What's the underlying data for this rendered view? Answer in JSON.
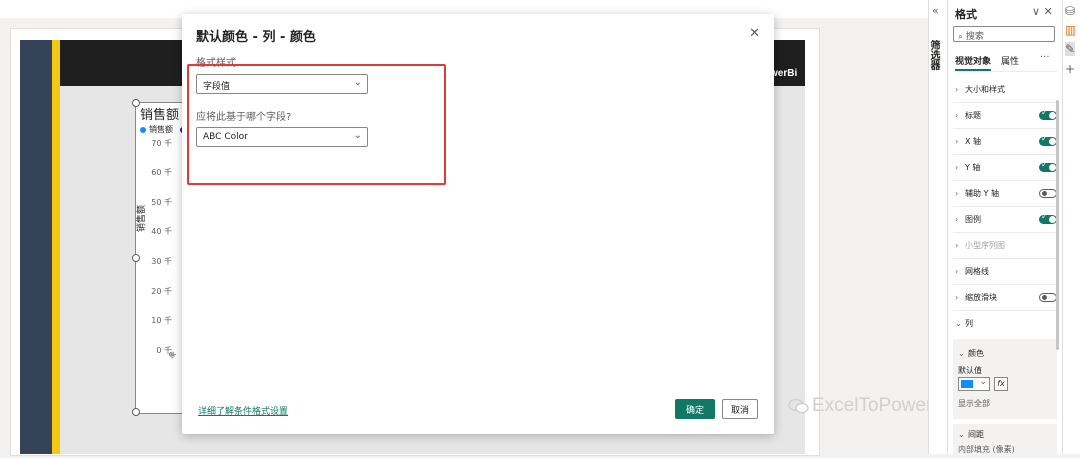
{
  "report": {
    "logo_text": "werBi",
    "chart_title": "销售额 和",
    "legend": [
      "销售额"
    ],
    "y_axis_label": "销售额",
    "y_ticks": [
      "70 千",
      "60 千",
      "50 千",
      "40 千",
      "30 千",
      "20 千",
      "10 千",
      "0 千"
    ],
    "x_tick": "象"
  },
  "dialog": {
    "title": "默认颜色 - 列 - 颜色",
    "close": "✕",
    "format_style_label": "格式样式",
    "format_style_value": "字段值",
    "field_question": "应将此基于哪个字段?",
    "field_value": "ABC Color",
    "learn_more": "详细了解条件格式设置",
    "ok": "确定",
    "cancel": "取消"
  },
  "filter_pane": {
    "collapse": "«",
    "label": "筛选器"
  },
  "format_pane": {
    "title": "格式",
    "actions": "∨ ✕",
    "search_placeholder": "搜索",
    "tabs": [
      "视觉对象",
      "属性"
    ],
    "more": "···",
    "sections": [
      {
        "label": "大小和样式",
        "toggle": null,
        "dim": false
      },
      {
        "label": "标题",
        "toggle": "on",
        "dim": false
      },
      {
        "label": "X 轴",
        "toggle": "on",
        "dim": false
      },
      {
        "label": "Y 轴",
        "toggle": "on",
        "dim": false
      },
      {
        "label": "辅助 Y 轴",
        "toggle": "off",
        "dim": false
      },
      {
        "label": "图例",
        "toggle": "on",
        "dim": false
      },
      {
        "label": "小型序列图",
        "toggle": null,
        "dim": true
      },
      {
        "label": "网格线",
        "toggle": null,
        "dim": false
      },
      {
        "label": "缩放滑块",
        "toggle": "off",
        "dim": false
      }
    ],
    "columns_label": "列",
    "color_group": "颜色",
    "default_value_label": "默认值",
    "color_hex": "#118DFF",
    "fx": "fx",
    "show_all": "显示全部",
    "spacing_group": "间距",
    "inner_padding": "内部填充 (像素)"
  },
  "watermark": "ExcelToPowerBI",
  "colors": {
    "accent": "#117865",
    "highlight_box": "#E03A3A",
    "navy": "#344358",
    "yellow": "#F2C811"
  }
}
